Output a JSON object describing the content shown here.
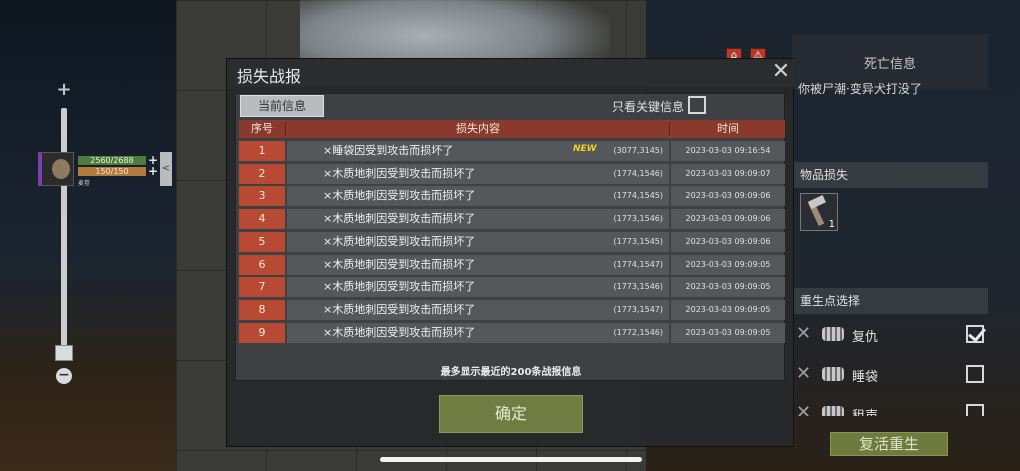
{
  "hud": {
    "hp": "2560/2688",
    "food": "150/150",
    "name": "麦卷",
    "collapse_icon": "<"
  },
  "zoom": {
    "plus": "+",
    "minus": "−"
  },
  "right_panel": {
    "death_title": "死亡信息",
    "death_message": "你被尸潮·变异犬打没了",
    "items_lost_title": "物品损失",
    "item_count": "1",
    "respawn_title": "重生点选择",
    "respawn_options": [
      {
        "label": "复仇",
        "checked": true
      },
      {
        "label": "睡袋",
        "checked": false
      },
      {
        "label": "租声",
        "checked": false
      }
    ],
    "revive_button": "复活重生"
  },
  "modal": {
    "title": "损失战报",
    "close_icon": "close-icon",
    "tab_current": "当前信息",
    "key_only_label": "只看关键信息",
    "columns": [
      "序号",
      "损失内容",
      "时间"
    ],
    "rows": [
      {
        "num": "1",
        "content": "×睡袋因受到攻击而损坏了",
        "coords": "(3077,3145)",
        "time": "2023-03-03 09:16:54",
        "new": "NEW"
      },
      {
        "num": "2",
        "content": "×木质地刺因受到攻击而损坏了",
        "coords": "(1774,1546)",
        "time": "2023-03-03 09:09:07",
        "new": ""
      },
      {
        "num": "3",
        "content": "×木质地刺因受到攻击而损坏了",
        "coords": "(1774,1545)",
        "time": "2023-03-03 09:09:06",
        "new": ""
      },
      {
        "num": "4",
        "content": "×木质地刺因受到攻击而损坏了",
        "coords": "(1773,1546)",
        "time": "2023-03-03 09:09:06",
        "new": ""
      },
      {
        "num": "5",
        "content": "×木质地刺因受到攻击而损坏了",
        "coords": "(1773,1545)",
        "time": "2023-03-03 09:09:06",
        "new": ""
      },
      {
        "num": "6",
        "content": "×木质地刺因受到攻击而损坏了",
        "coords": "(1774,1547)",
        "time": "2023-03-03 09:09:05",
        "new": ""
      },
      {
        "num": "7",
        "content": "×木质地刺因受到攻击而损坏了",
        "coords": "(1773,1546)",
        "time": "2023-03-03 09:09:05",
        "new": ""
      },
      {
        "num": "8",
        "content": "×木质地刺因受到攻击而损坏了",
        "coords": "(1773,1547)",
        "time": "2023-03-03 09:09:05",
        "new": ""
      },
      {
        "num": "9",
        "content": "×木质地刺因受到攻击而损坏了",
        "coords": "(1772,1546)",
        "time": "2023-03-03 09:09:05",
        "new": ""
      }
    ],
    "footer_note": "最多显示最近的200条战报信息",
    "confirm_button": "确定"
  }
}
